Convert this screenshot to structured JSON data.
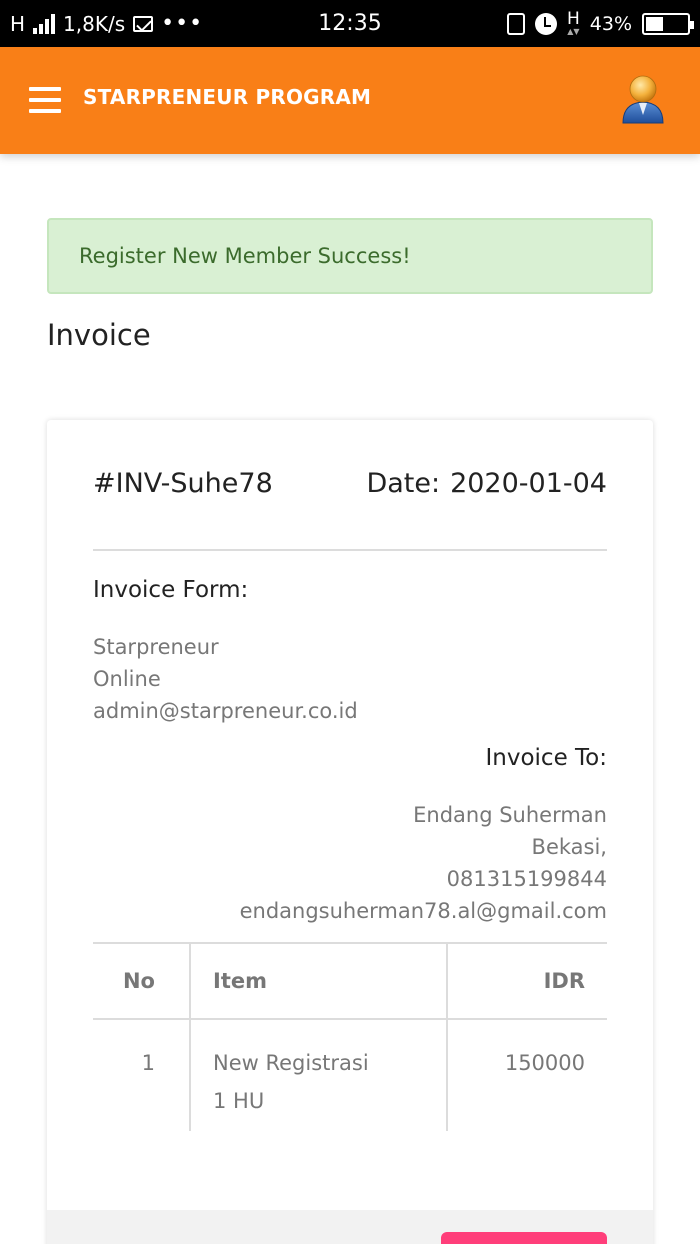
{
  "status_bar": {
    "network_type": "H",
    "speed": "1,8K/s",
    "more": "•••",
    "time": "12:35",
    "data_indicator": "H",
    "battery": "43%",
    "battery_level": 0.43
  },
  "app_bar": {
    "title": "STARPRENEUR PROGRAM",
    "accent_color": "#f97f17"
  },
  "alert": {
    "message": "Register New Member Success!"
  },
  "page": {
    "title": "Invoice"
  },
  "invoice": {
    "number": "#INV-Suhe78",
    "date_label": "Date:",
    "date": "2020-01-04",
    "from_label": "Invoice Form:",
    "from_lines": [
      "Starpreneur",
      "Online",
      "admin@starpreneur.co.id"
    ],
    "to_label": "Invoice To:",
    "to_lines": [
      "Endang Suherman",
      "Bekasi,",
      "081315199844",
      "endangsuherman78.al@gmail.com"
    ],
    "table": {
      "headers": [
        "No",
        "Item",
        "IDR"
      ],
      "rows": [
        {
          "no": "1",
          "item_line1": "New Registrasi",
          "item_line2": "1 HU",
          "idr": "150000"
        }
      ]
    }
  }
}
